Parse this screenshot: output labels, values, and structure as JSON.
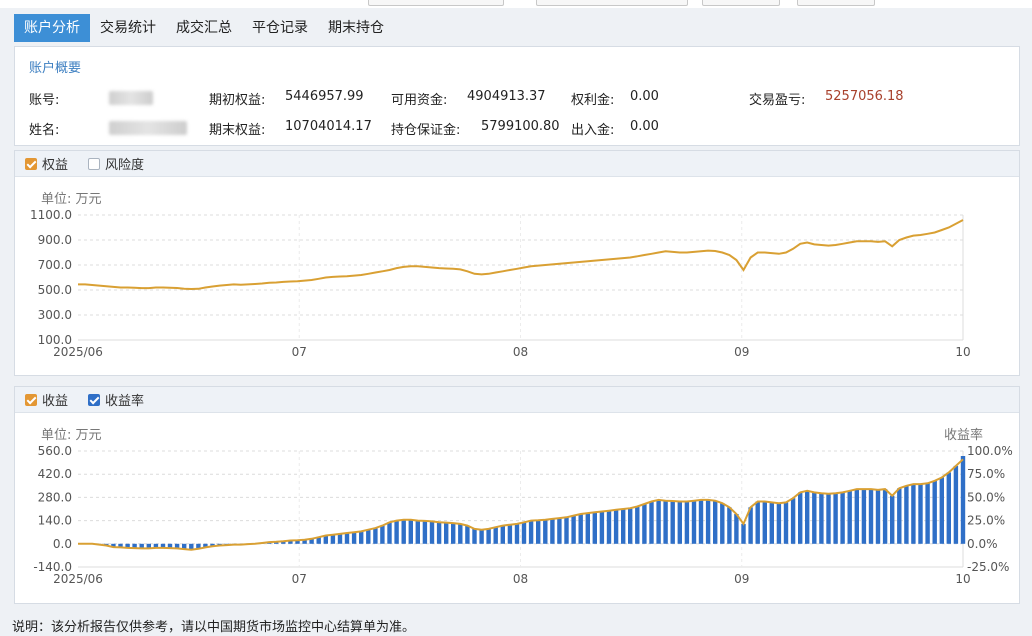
{
  "tabs": [
    "账户分析",
    "交易统计",
    "成交汇总",
    "平仓记录",
    "期末持仓"
  ],
  "overview": {
    "title": "账户概要",
    "account_label": "账号:",
    "name_label": "姓名:",
    "initial_equity_label": "期初权益:",
    "initial_equity": "5446957.99",
    "final_equity_label": "期末权益:",
    "final_equity": "10704014.17",
    "available_label": "可用资金:",
    "available": "4904913.37",
    "margin_label": "持仓保证金:",
    "margin": "5799100.80",
    "royalty_label": "权利金:",
    "royalty": "0.00",
    "inout_label": "出入金:",
    "inout": "0.00",
    "pnl_label": "交易盈亏:",
    "pnl": "5257056.18"
  },
  "equity_panel": {
    "opt_equity": "权益",
    "opt_risk": "风险度",
    "unit": "单位: 万元"
  },
  "profit_panel": {
    "opt_profit": "收益",
    "opt_rate": "收益率",
    "unit": "单位: 万元",
    "right_unit": "收益率"
  },
  "note": "说明：该分析报告仅供参考，请以中国期货市场监控中心结算单为准。",
  "colors": {
    "line": "#d9a033",
    "bar": "#2f6fc7",
    "active_tab": "#3d8fd6",
    "pnl": "#a8412c"
  },
  "chart_data": [
    {
      "type": "line",
      "title": "",
      "ylabel": "单位: 万元",
      "ylim": [
        100,
        1100
      ],
      "yticks": [
        "1100.0",
        "900.0",
        "700.0",
        "500.0",
        "300.0",
        "100.0"
      ],
      "xtick_labels": [
        "2025/06",
        "07",
        "08",
        "09",
        "10"
      ],
      "grid": true,
      "series": [
        {
          "values": [
            545,
            545,
            540,
            535,
            530,
            525,
            520,
            520,
            518,
            515,
            515,
            520,
            520,
            518,
            516,
            510,
            508,
            510,
            520,
            528,
            535,
            540,
            545,
            542,
            545,
            548,
            552,
            558,
            560,
            565,
            568,
            570,
            575,
            580,
            590,
            600,
            605,
            608,
            610,
            615,
            620,
            630,
            640,
            650,
            660,
            675,
            685,
            690,
            690,
            685,
            680,
            675,
            672,
            670,
            665,
            650,
            630,
            625,
            630,
            640,
            650,
            660,
            670,
            680,
            690,
            695,
            700,
            705,
            710,
            715,
            720,
            725,
            730,
            735,
            740,
            745,
            750,
            755,
            760,
            770,
            780,
            790,
            800,
            810,
            805,
            800,
            800,
            805,
            810,
            815,
            812,
            800,
            780,
            740,
            660,
            760,
            800,
            800,
            795,
            790,
            800,
            830,
            870,
            880,
            865,
            860,
            855,
            860,
            870,
            880,
            890,
            890,
            890,
            885,
            890,
            850,
            900,
            920,
            935,
            940,
            950,
            960,
            980,
            1000,
            1030,
            1060
          ]
        }
      ]
    },
    {
      "type": "bar",
      "title": "",
      "ylabel": "单位: 万元",
      "ylim": [
        -140,
        560
      ],
      "yticks": [
        "560.0",
        "420.0",
        "280.0",
        "140.0",
        "0.0",
        "-140.0"
      ],
      "y2label": "收益率",
      "y2lim": [
        -25,
        100
      ],
      "y2ticks": [
        "100.0%",
        "75.0%",
        "50.0%",
        "25.0%",
        "0.0%",
        "-25.0%"
      ],
      "xtick_labels": [
        "2025/06",
        "07",
        "08",
        "09",
        "10"
      ],
      "grid": true,
      "series": [
        {
          "name": "收益",
          "type": "line",
          "values": [
            0,
            0,
            0,
            -5,
            -10,
            -20,
            -22,
            -25,
            -26,
            -28,
            -28,
            -25,
            -25,
            -26,
            -28,
            -32,
            -36,
            -30,
            -22,
            -15,
            -10,
            -8,
            -5,
            -5,
            -2,
            0,
            5,
            10,
            12,
            15,
            20,
            22,
            25,
            30,
            40,
            50,
            55,
            60,
            65,
            70,
            75,
            85,
            95,
            110,
            130,
            140,
            145,
            145,
            140,
            138,
            135,
            130,
            128,
            125,
            120,
            110,
            90,
            85,
            90,
            100,
            110,
            115,
            120,
            130,
            140,
            142,
            145,
            150,
            155,
            160,
            170,
            180,
            185,
            190,
            195,
            200,
            205,
            210,
            215,
            225,
            240,
            255,
            265,
            260,
            258,
            255,
            255,
            260,
            265,
            265,
            260,
            245,
            220,
            180,
            120,
            220,
            255,
            255,
            250,
            245,
            250,
            275,
            310,
            320,
            310,
            305,
            302,
            305,
            310,
            320,
            330,
            330,
            330,
            325,
            330,
            290,
            335,
            350,
            360,
            360,
            365,
            380,
            400,
            430,
            470,
            510
          ]
        },
        {
          "name": "收益率",
          "type": "bar",
          "values": [
            0,
            0,
            0,
            -5,
            -10,
            -20,
            -22,
            -25,
            -26,
            -28,
            -28,
            -25,
            -25,
            -26,
            -28,
            -32,
            -36,
            -30,
            -22,
            -15,
            -10,
            -8,
            -5,
            -5,
            -2,
            0,
            5,
            10,
            12,
            15,
            20,
            22,
            25,
            30,
            40,
            50,
            55,
            60,
            65,
            70,
            75,
            85,
            95,
            110,
            130,
            140,
            145,
            145,
            140,
            138,
            135,
            130,
            128,
            125,
            120,
            110,
            90,
            85,
            90,
            100,
            110,
            115,
            120,
            130,
            140,
            142,
            145,
            150,
            155,
            160,
            170,
            180,
            185,
            190,
            195,
            200,
            205,
            210,
            215,
            225,
            240,
            255,
            265,
            260,
            258,
            255,
            255,
            260,
            265,
            265,
            260,
            245,
            220,
            180,
            120,
            220,
            255,
            255,
            250,
            245,
            250,
            275,
            310,
            320,
            310,
            305,
            302,
            305,
            310,
            320,
            330,
            330,
            330,
            325,
            330,
            290,
            335,
            350,
            360,
            360,
            365,
            380,
            400,
            430,
            470,
            530
          ]
        }
      ]
    }
  ]
}
